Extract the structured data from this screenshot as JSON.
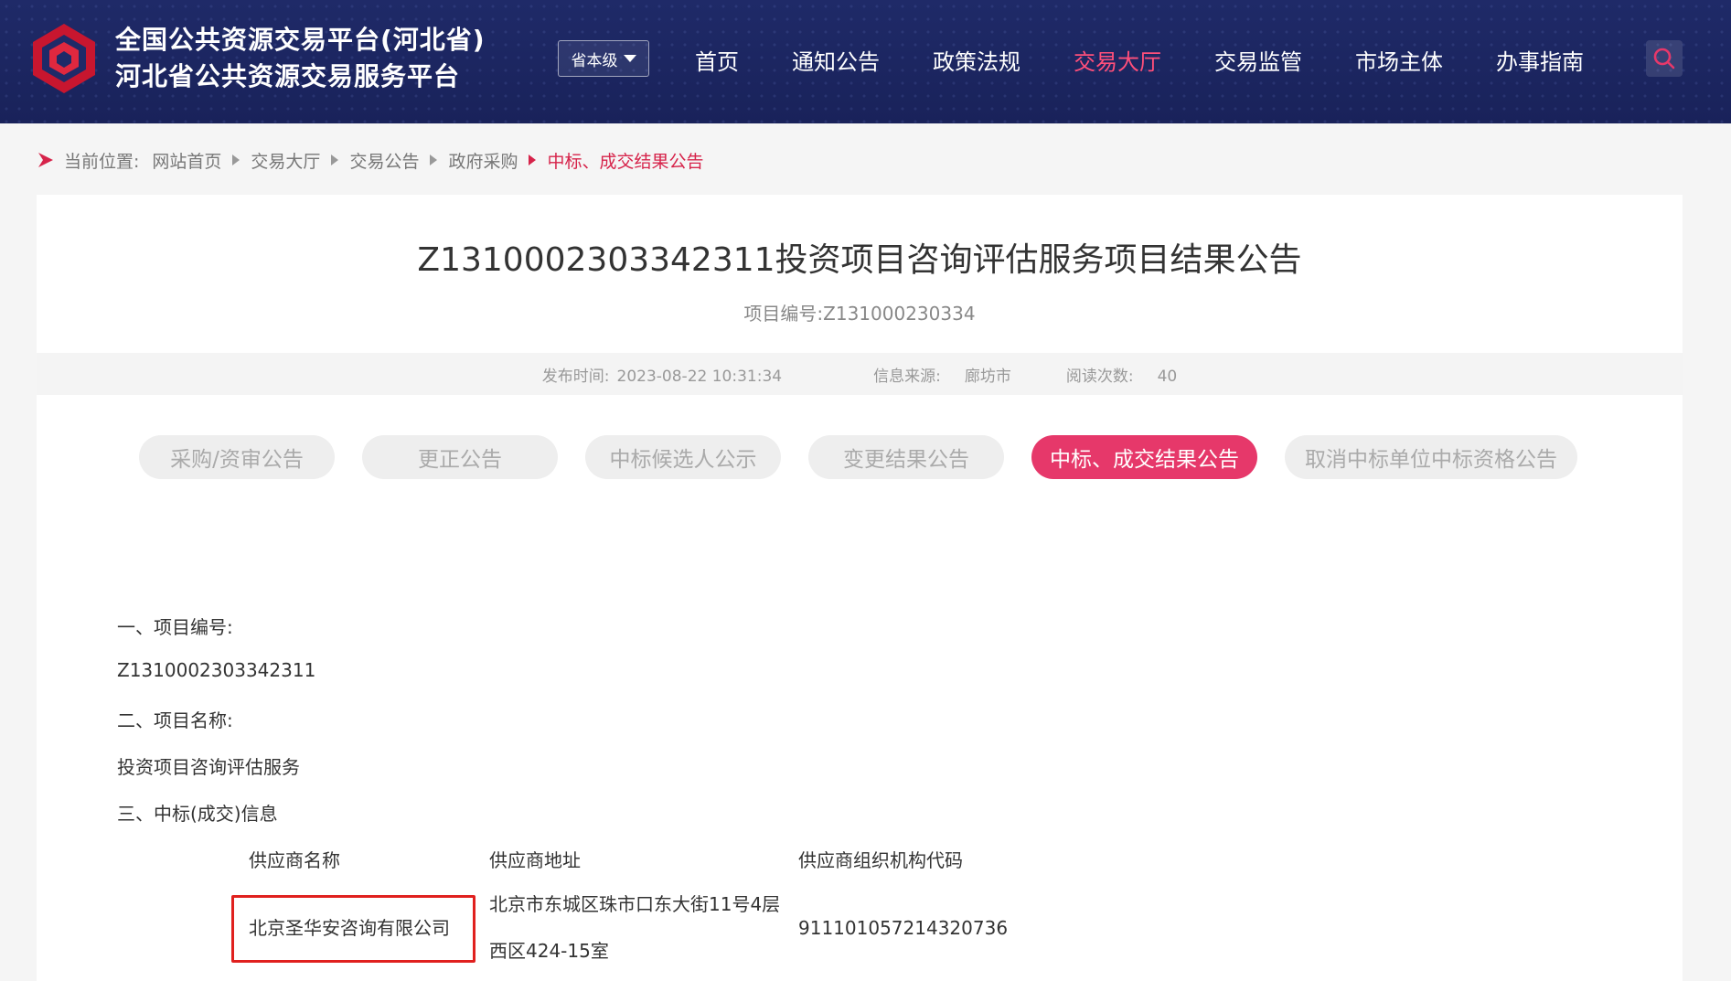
{
  "header": {
    "title_line1": "全国公共资源交易平台(河北省)",
    "title_line2": "河北省公共资源交易服务平台",
    "level_select": "省本级",
    "nav": [
      "首页",
      "通知公告",
      "政策法规",
      "交易大厅",
      "交易监管",
      "市场主体",
      "办事指南"
    ],
    "nav_active": "交易大厅",
    "accent": "#ff4f7a"
  },
  "breadcrumb": {
    "label": "当前位置:",
    "items": [
      "网站首页",
      "交易大厅",
      "交易公告",
      "政府采购"
    ],
    "current": "中标、成交结果公告"
  },
  "document": {
    "title": "Z1310002303342311投资项目咨询评估服务项目结果公告",
    "project_no": "项目编号:Z131000230334",
    "publish_label": "发布时间:",
    "publish_value": "2023-08-22 10:31:34",
    "source_label": "信息来源:",
    "source_value": "廊坊市",
    "views_label": "阅读次数:",
    "views_value": "40"
  },
  "tabs": [
    {
      "label": "采购/资审公告"
    },
    {
      "label": "更正公告"
    },
    {
      "label": "中标候选人公示"
    },
    {
      "label": "变更结果公告"
    },
    {
      "label": "中标、成交结果公告"
    },
    {
      "label": "取消中标单位中标资格公告"
    }
  ],
  "tabs_active_index": 4,
  "body": {
    "s1_heading": "一、项目编号:",
    "s1_value": "Z1310002303342311",
    "s2_heading": "二、项目名称:",
    "s2_value": "投资项目咨询评估服务",
    "s3_heading": "三、中标(成交)信息",
    "table": {
      "headers": [
        "供应商名称",
        "供应商地址",
        "供应商组织机构代码"
      ],
      "row": {
        "name": "北京圣华安咨询有限公司",
        "address_line1": "北京市东城区珠市口东大街11号4层",
        "address_line2": "西区424-15室",
        "code": "911101057214320736"
      }
    }
  }
}
